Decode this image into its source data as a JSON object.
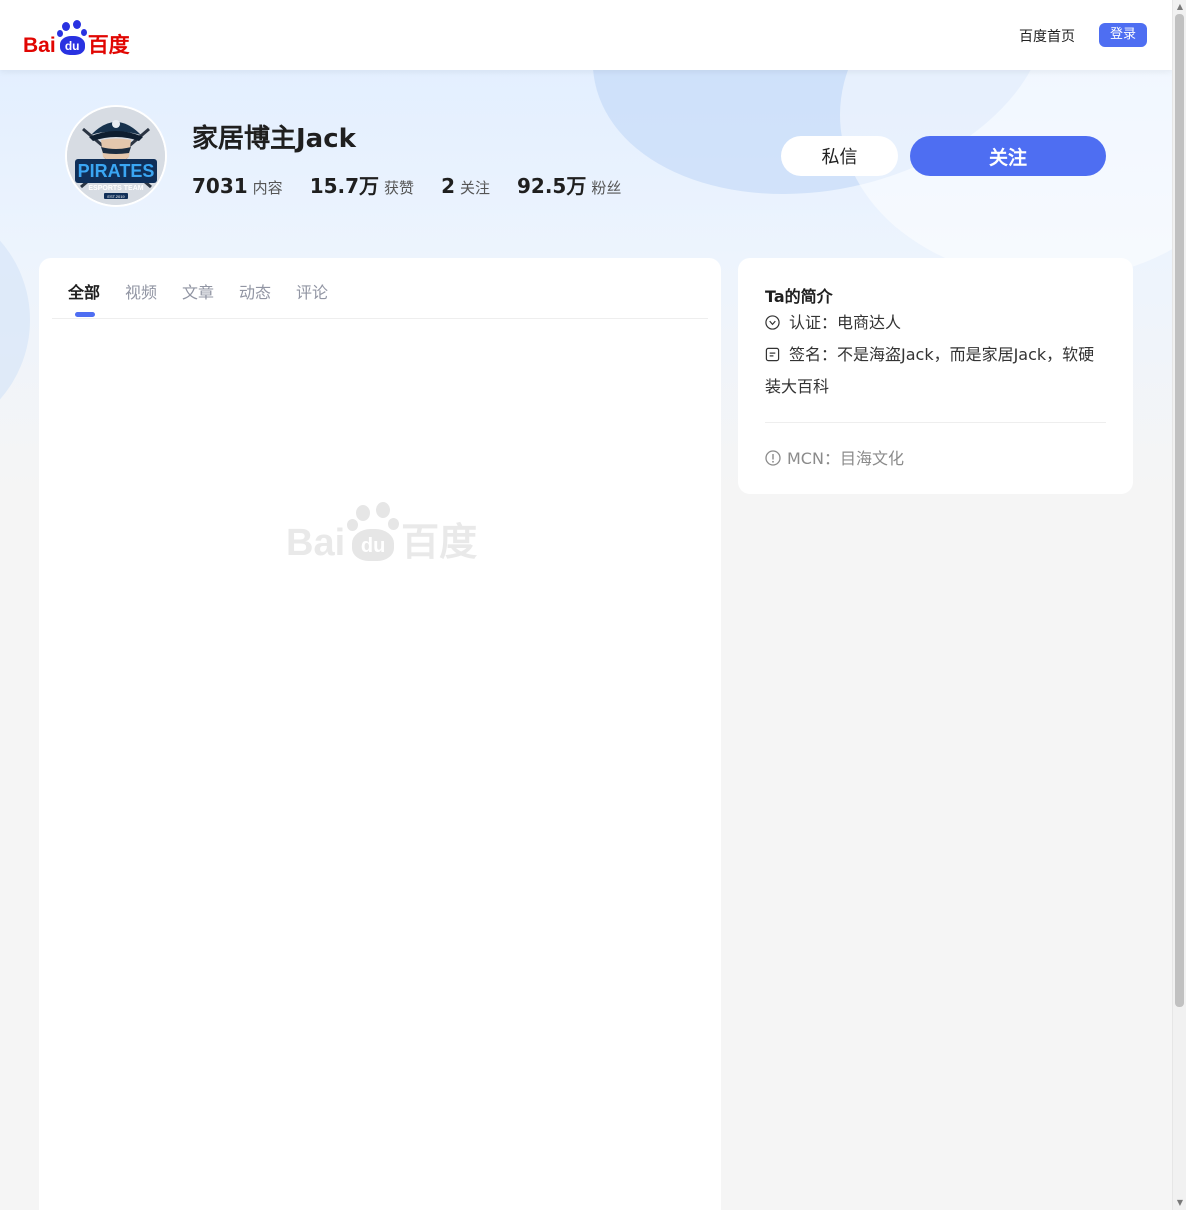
{
  "header": {
    "logo": {
      "left": "Bai",
      "paw": "du",
      "right": "百度"
    },
    "nav_home": "百度首页",
    "login": "登录"
  },
  "profile": {
    "name": "家居博主Jack",
    "avatar_text": {
      "line1": "PIRATES",
      "line2": "ESPORTS TEAM",
      "line3": "EST.2019"
    },
    "stats": [
      {
        "value": "7031",
        "label": "内容"
      },
      {
        "value": "15.7万",
        "label": "获赞"
      },
      {
        "value": "2",
        "label": "关注"
      },
      {
        "value": "92.5万",
        "label": "粉丝"
      }
    ],
    "message_button": "私信",
    "follow_button": "关注"
  },
  "tabs": [
    {
      "label": "全部",
      "active": true
    },
    {
      "label": "视频",
      "active": false
    },
    {
      "label": "文章",
      "active": false
    },
    {
      "label": "动态",
      "active": false
    },
    {
      "label": "评论",
      "active": false
    }
  ],
  "watermark": {
    "left": "Bai",
    "paw": "du",
    "right": "百度"
  },
  "intro": {
    "title": "Ta的简介",
    "certification": "认证：电商达人",
    "signature": "签名：不是海盗Jack，而是家居Jack，软硬装大百科",
    "mcn": "MCN：目海文化"
  },
  "icons": {
    "certification": "check-circle-icon",
    "signature": "note-icon",
    "mcn": "exclamation-circle-icon"
  },
  "colors": {
    "brand_blue": "#4e6ef2",
    "baidu_red": "#e10602",
    "baidu_paw_blue": "#2932e1"
  }
}
